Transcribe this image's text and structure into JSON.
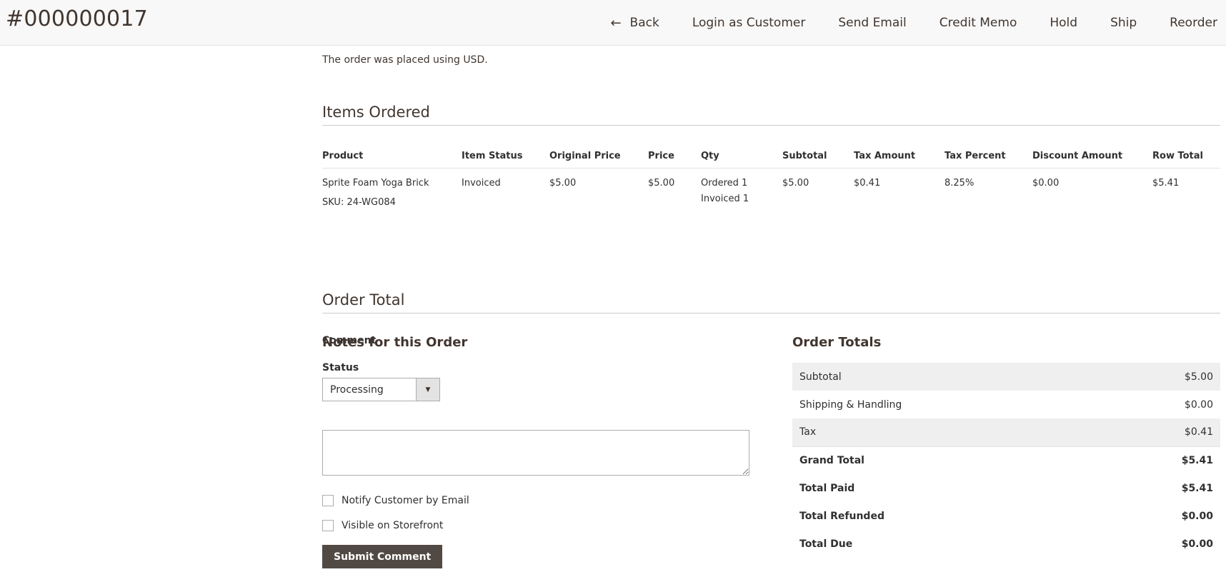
{
  "header": {
    "order_title": "#000000017",
    "actions": {
      "back": "Back",
      "login_as_customer": "Login as Customer",
      "send_email": "Send Email",
      "credit_memo": "Credit Memo",
      "hold": "Hold",
      "ship": "Ship",
      "reorder": "Reorder"
    }
  },
  "account": {
    "currency_note": "The order was placed using USD."
  },
  "items_ordered": {
    "title": "Items Ordered",
    "columns": [
      "Product",
      "Item Status",
      "Original Price",
      "Price",
      "Qty",
      "Subtotal",
      "Tax Amount",
      "Tax Percent",
      "Discount Amount",
      "Row Total"
    ],
    "rows": [
      {
        "product_name": "Sprite Foam Yoga Brick",
        "sku": "SKU: 24-WG084",
        "item_status": "Invoiced",
        "original_price": "$5.00",
        "price": "$5.00",
        "qty_ordered": "Ordered 1",
        "qty_invoiced": "Invoiced 1",
        "subtotal": "$5.00",
        "tax_amount": "$0.41",
        "tax_percent": "8.25%",
        "discount_amount": "$0.00",
        "row_total": "$5.41"
      }
    ]
  },
  "order_total": {
    "title": "Order Total",
    "notes": {
      "title": "Notes for this Order",
      "status_label": "Status",
      "status_value": "Processing",
      "comment_label": "Comment",
      "comment_value": "",
      "notify_label": "Notify Customer by Email",
      "visible_label": "Visible on Storefront",
      "submit_label": "Submit Comment"
    },
    "totals": {
      "title": "Order Totals",
      "rows": [
        {
          "label": "Subtotal",
          "value": "$5.00"
        },
        {
          "label": "Shipping & Handling",
          "value": "$0.00"
        },
        {
          "label": "Tax",
          "value": "$0.41"
        },
        {
          "label": "Grand Total",
          "value": "$5.41"
        },
        {
          "label": "Total Paid",
          "value": "$5.41"
        },
        {
          "label": "Total Refunded",
          "value": "$0.00"
        },
        {
          "label": "Total Due",
          "value": "$0.00"
        }
      ]
    }
  },
  "icons": {
    "back": "arrow-left-icon",
    "select": "caret-down-icon"
  },
  "colors": {
    "header_bg": "#f8f8f8",
    "primary_button": "#514943",
    "text_dark": "#41362f",
    "row_shade": "#efefef"
  }
}
